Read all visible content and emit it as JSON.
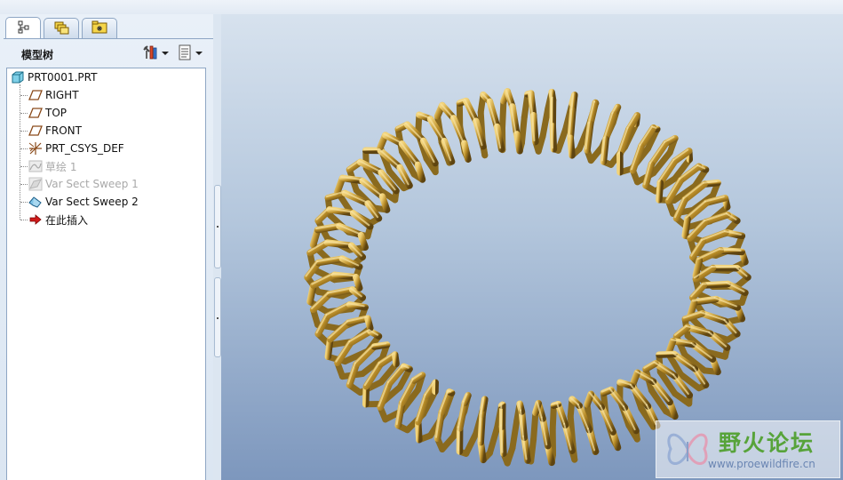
{
  "panel": {
    "tabs": [
      {
        "name": "model-tree-tab-icon",
        "active": true
      },
      {
        "name": "layers-tab-icon",
        "active": false
      },
      {
        "name": "folder-tab-icon",
        "active": false
      }
    ],
    "title": "模型树",
    "settings_icon": "tools-icon",
    "show_icon": "list-icon"
  },
  "tree": {
    "items": [
      {
        "label": "PRT0001.PRT",
        "icon": "part-icon",
        "state": "normal"
      },
      {
        "label": "RIGHT",
        "icon": "datum-plane-icon",
        "state": "normal"
      },
      {
        "label": "TOP",
        "icon": "datum-plane-icon",
        "state": "normal"
      },
      {
        "label": "FRONT",
        "icon": "datum-plane-icon",
        "state": "normal"
      },
      {
        "label": "PRT_CSYS_DEF",
        "icon": "csys-icon",
        "state": "normal"
      },
      {
        "label": "草绘 1",
        "icon": "sketch-icon",
        "state": "suppressed"
      },
      {
        "label": "Var Sect Sweep 1",
        "icon": "sweep-icon",
        "state": "suppressed"
      },
      {
        "label": "Var Sect Sweep 2",
        "icon": "sweep-icon",
        "state": "normal"
      },
      {
        "label": "在此插入",
        "icon": "insert-here-arrow-icon",
        "state": "normal"
      }
    ]
  },
  "viewport": {
    "model": "helical-spring-torus",
    "spring_color": "#b8922e"
  },
  "watermark": {
    "title": "野火论坛",
    "url": "www.proewildfire.cn"
  }
}
